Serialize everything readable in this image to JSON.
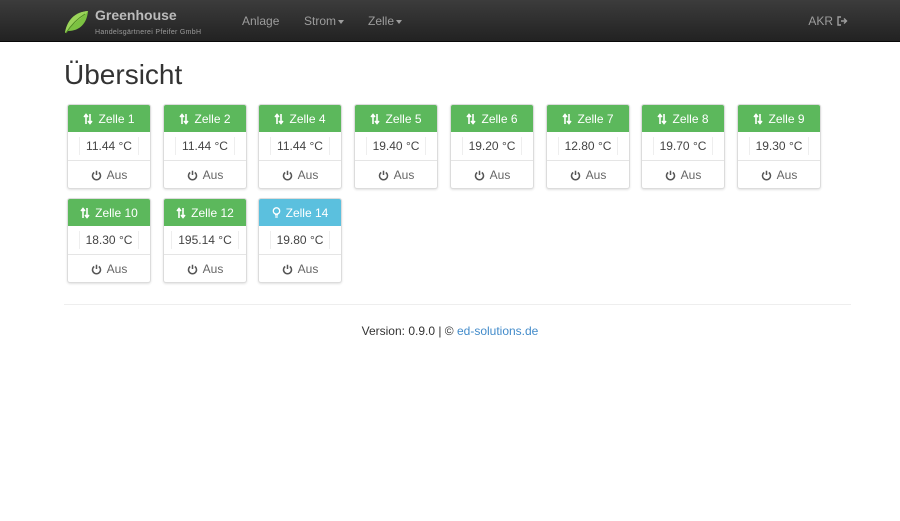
{
  "navbar": {
    "brand_title": "Greenhouse",
    "brand_subtitle": "Handelsgärtnerei Pfeifer GmbH",
    "items": [
      {
        "label": "Anlage",
        "dropdown": false
      },
      {
        "label": "Strom",
        "dropdown": true
      },
      {
        "label": "Zelle",
        "dropdown": true
      }
    ],
    "user": "AKR",
    "user_icon": "logout-icon"
  },
  "page_title": "Übersicht",
  "cells": [
    {
      "name": "Zelle 1",
      "temp": "11.44 °C",
      "power": "Aus",
      "status": "green",
      "icon": "sort-arrows-icon"
    },
    {
      "name": "Zelle 2",
      "temp": "11.44 °C",
      "power": "Aus",
      "status": "green",
      "icon": "sort-arrows-icon"
    },
    {
      "name": "Zelle 4",
      "temp": "11.44 °C",
      "power": "Aus",
      "status": "green",
      "icon": "sort-arrows-icon"
    },
    {
      "name": "Zelle 5",
      "temp": "19.40 °C",
      "power": "Aus",
      "status": "green",
      "icon": "sort-arrows-icon"
    },
    {
      "name": "Zelle 6",
      "temp": "19.20 °C",
      "power": "Aus",
      "status": "green",
      "icon": "sort-arrows-icon"
    },
    {
      "name": "Zelle 7",
      "temp": "12.80 °C",
      "power": "Aus",
      "status": "green",
      "icon": "sort-arrows-icon"
    },
    {
      "name": "Zelle 8",
      "temp": "19.70 °C",
      "power": "Aus",
      "status": "green",
      "icon": "sort-arrows-icon"
    },
    {
      "name": "Zelle 9",
      "temp": "19.30 °C",
      "power": "Aus",
      "status": "green",
      "icon": "sort-arrows-icon"
    },
    {
      "name": "Zelle 10",
      "temp": "18.30 °C",
      "power": "Aus",
      "status": "green",
      "icon": "sort-arrows-icon"
    },
    {
      "name": "Zelle 12",
      "temp": "195.14 °C",
      "power": "Aus",
      "status": "green",
      "icon": "sort-arrows-icon"
    },
    {
      "name": "Zelle 14",
      "temp": "19.80 °C",
      "power": "Aus",
      "status": "blue",
      "icon": "lightbulb-icon"
    }
  ],
  "colors": {
    "green": "#5cb85c",
    "blue": "#5bc0de",
    "navbar": "#222222",
    "link": "#428bca"
  },
  "footer": {
    "version_text": "Version: 0.9.0 | © ",
    "link_text": "ed-solutions.de"
  }
}
